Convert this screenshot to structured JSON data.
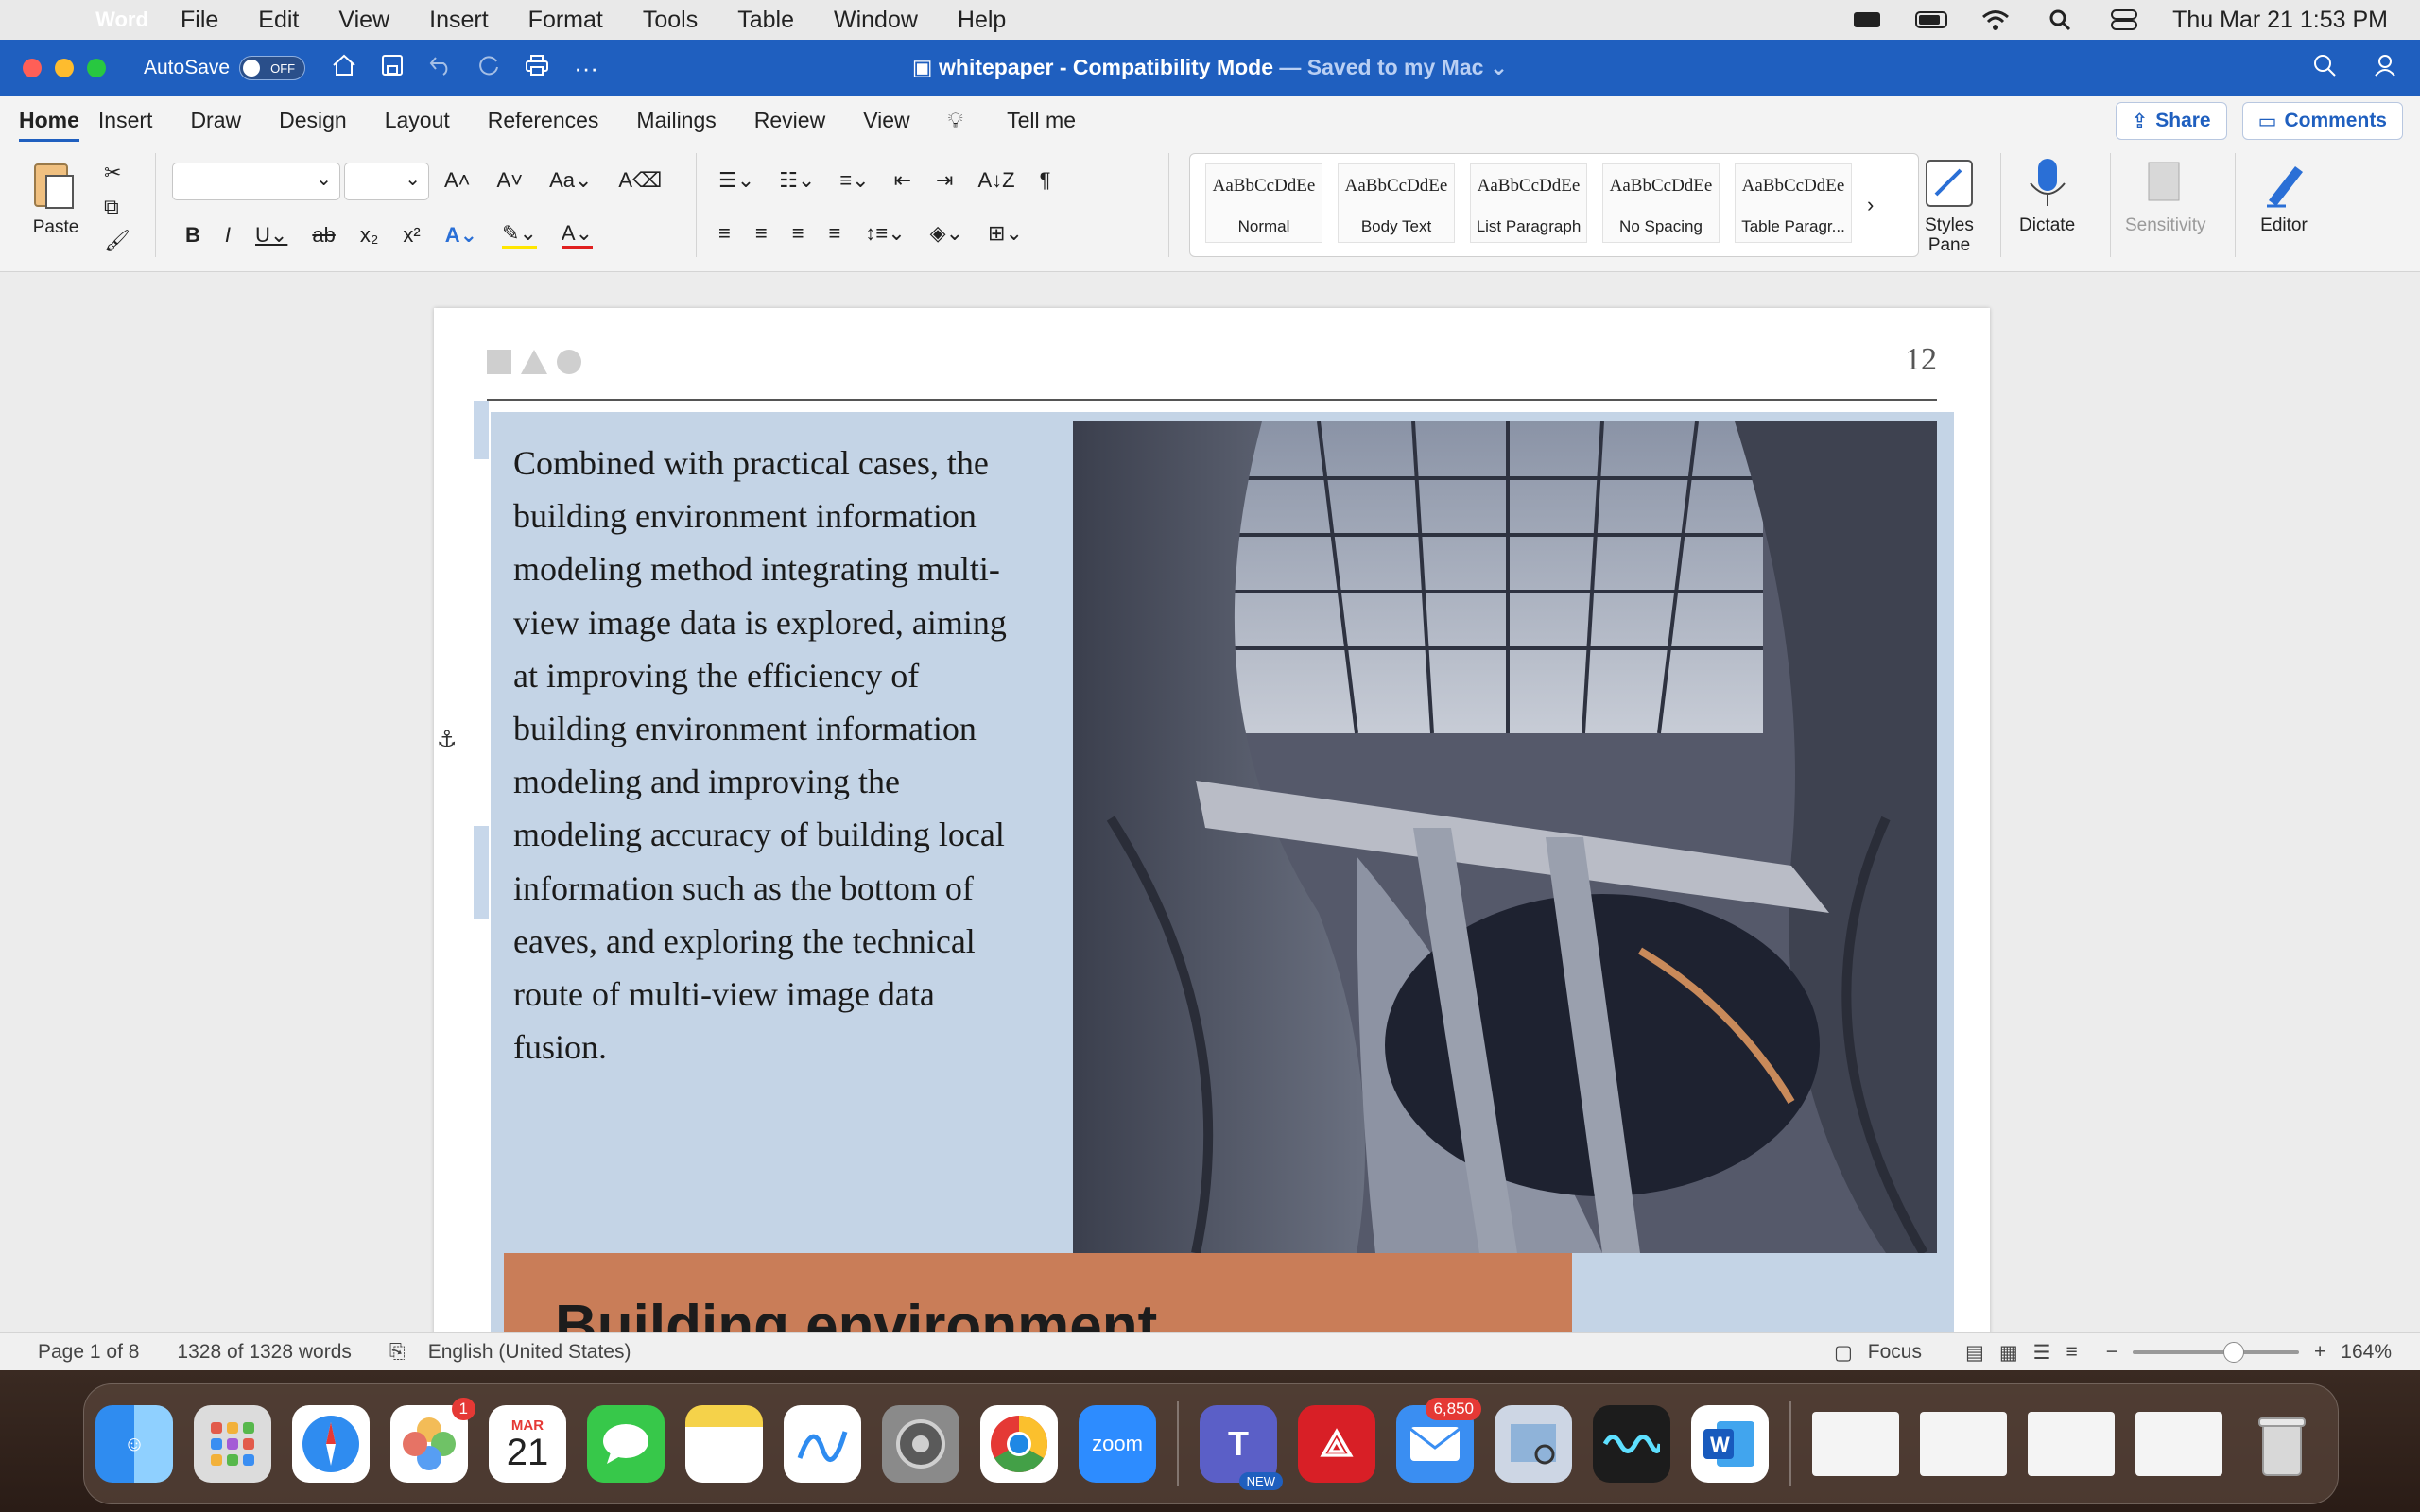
{
  "menubar": {
    "app": "Word",
    "items": [
      "File",
      "Edit",
      "View",
      "Insert",
      "Format",
      "Tools",
      "Table",
      "Window",
      "Help"
    ],
    "clock": "Thu Mar 21  1:53 PM"
  },
  "titlebar": {
    "autosave_label": "AutoSave",
    "autosave_state": "OFF",
    "doc_name": "whitepaper",
    "separator": " - ",
    "mode": "Compatibility Mode",
    "saved": " — Saved to my Mac ⌄"
  },
  "ribbon": {
    "tabs": [
      "Home",
      "Insert",
      "Draw",
      "Design",
      "Layout",
      "References",
      "Mailings",
      "Review",
      "View",
      "Tell me"
    ],
    "share_label": "Share",
    "comments_label": "Comments",
    "paste_label": "Paste",
    "styles": [
      {
        "sample": "AaBbCcDdEe",
        "name": "Normal"
      },
      {
        "sample": "AaBbCcDdEe",
        "name": "Body Text"
      },
      {
        "sample": "AaBbCcDdEe",
        "name": "List Paragraph"
      },
      {
        "sample": "AaBbCcDdEe",
        "name": "No Spacing"
      },
      {
        "sample": "AaBbCcDdEe",
        "name": "Table Paragr..."
      }
    ],
    "styles_pane_label": "Styles\nPane",
    "dictate_label": "Dictate",
    "sensitivity_label": "Sensitivity",
    "editor_label": "Editor"
  },
  "document": {
    "page_number": "12",
    "body": "Combined with practical cases, the building environment information modeling method integrating multi-view image data is explored, aiming at improving the efficiency of building environment information modeling and improving the modeling accuracy of building local information such as the bottom of eaves, and exploring the technical route of multi-view image data fusion.",
    "heading": "Building environment"
  },
  "status": {
    "page": "Page 1 of 8",
    "words": "1328 of 1328 words",
    "language": "English (United States)",
    "focus": "Focus",
    "zoom": "164%"
  },
  "dock": {
    "calendar_month": "MAR",
    "calendar_day": "21",
    "photos_badge": "1",
    "mail_badge": "6,850",
    "zoom_label": "zoom",
    "teams_tag": "NEW"
  }
}
